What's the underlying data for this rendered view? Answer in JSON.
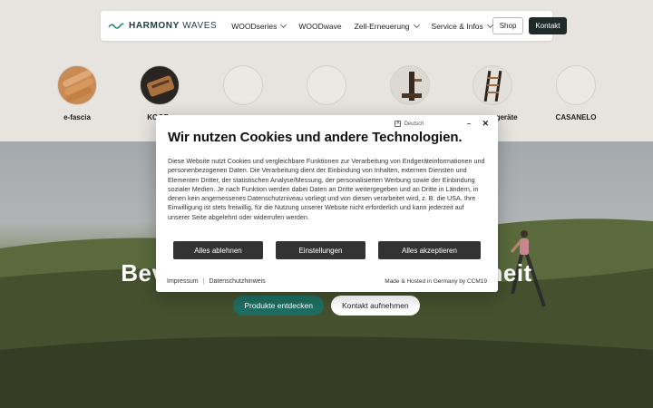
{
  "nav": {
    "logo_text_bold": "HARMONY",
    "logo_text": "WAVES",
    "items": [
      {
        "label": "WOODseries",
        "dropdown": true
      },
      {
        "label": "WOODwave",
        "dropdown": false
      },
      {
        "label": "Zell-Erneuerung",
        "dropdown": true
      },
      {
        "label": "Service & Infos",
        "dropdown": true
      }
    ],
    "shop_label": "Shop",
    "kontakt_label": "Kontakt"
  },
  "categories": [
    {
      "label": "e-fascia",
      "image": "wood-rollers"
    },
    {
      "label": "KOOF...",
      "image": "wood-device"
    },
    {
      "label": "",
      "image": "empty"
    },
    {
      "label": "",
      "image": "empty"
    },
    {
      "label": "",
      "image": "wood-stand"
    },
    {
      "label": "...geräte",
      "image": "wood-ladder"
    },
    {
      "label": "CASANELO",
      "image": "empty"
    }
  ],
  "hero": {
    "title_left": "Bev",
    "title_right": "heit",
    "primary_button": "Produkte entdecken",
    "secondary_button": "Kontakt aufnehmen"
  },
  "cookie": {
    "language": "Deutsch",
    "title": "Wir nutzen Cookies und andere Technologien.",
    "body": "Diese Website nutzt Cookies und vergleichbare Funktionen zur Verarbeitung von Endgeräteinformationen und personenbezogenen Daten. Die Verarbeitung dient der Einbindung von Inhalten, externen Diensten und Elementen Dritter, der statistischen Analyse/Messung, der personalisierten Werbung sowie der Einbindung sozialer Medien. Je nach Funktion werden dabei Daten an Dritte weitergegeben und an Dritte in Ländern, in denen kein angemessenes Datenschutzniveau vorliegt und von diesen verarbeitet wird, z. B. die USA. Ihre Einwilligung ist stets freiwillig, für die Nutzung unserer Website nicht erforderlich und kann jederzeit auf unserer Seite abgelehnt oder widerrufen werden.",
    "reject_label": "Alles ablehnen",
    "settings_label": "Einstellungen",
    "accept_label": "Alles akzeptieren",
    "impressum": "Impressum",
    "datenschutz": "Datenschutzhinweis",
    "hosted": "Made & Hosted in Germany by CCM19"
  },
  "colors": {
    "background": "#e7e4df",
    "brand_dark": "#1f2b29",
    "primary_green": "#1f6d61",
    "modal_button": "#333333"
  }
}
